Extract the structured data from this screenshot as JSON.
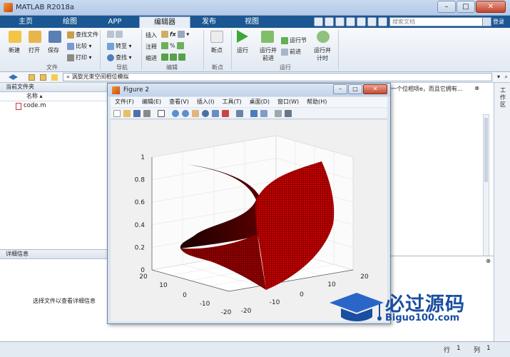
{
  "window": {
    "title": "MATLAB R2018a"
  },
  "tabs": [
    "主页",
    "绘图",
    "APP",
    "编辑器",
    "发布",
    "视图"
  ],
  "search": {
    "placeholder": "搜索文档",
    "login": "登录"
  },
  "ribbon": {
    "file": {
      "new": "新建",
      "open": "打开",
      "save": "保存",
      "find_files": "查找文件",
      "compare": "比较",
      "print": "打印",
      "label": "文件"
    },
    "navigate": {
      "goto": "转至",
      "find": "查找",
      "label": "导航"
    },
    "edit": {
      "insert": "插入",
      "comment": "注释",
      "indent": "缩进",
      "label": "编辑"
    },
    "breakpoints": {
      "label_btn": "断点",
      "label": "断点"
    },
    "run": {
      "run": "运行",
      "run_advance_1": "运行并",
      "run_advance_2": "前进",
      "run_section": "运行节",
      "advance": "前进",
      "run_time_1": "运行并",
      "run_time_2": "计时",
      "label": "运行"
    }
  },
  "address": {
    "path": "涡旋光束空间相位模拟",
    "chevron": "«"
  },
  "left_panel": {
    "title": "当前文件夹",
    "column": "名称",
    "files": [
      "code.m"
    ],
    "details_title": "详细信息",
    "details_msg": "选择文件以查看详细信息"
  },
  "editor": {
    "top_text": "有一个位相项e，而且它拥有..."
  },
  "right_strip": {
    "label": "工作区"
  },
  "status": {
    "row_label": "行",
    "row": "1",
    "col_label": "列",
    "col": "1"
  },
  "figure": {
    "title": "Figure 2",
    "menu": [
      "文件(F)",
      "编辑(E)",
      "查看(V)",
      "插入(I)",
      "工具(T)",
      "桌面(D)",
      "窗口(W)",
      "帮助(H)"
    ],
    "z_ticks": [
      "1",
      "0.8",
      "0.6",
      "0.4",
      "0.2",
      "0"
    ],
    "x_ticks": [
      "20",
      "10",
      "0",
      "-10",
      "-20"
    ],
    "y_ticks": [
      "-20",
      "-10",
      "0",
      "10",
      "20"
    ],
    "surface_color": "#cc0000"
  },
  "watermark": {
    "title": "必过源码",
    "url": "Biguo100.com"
  }
}
